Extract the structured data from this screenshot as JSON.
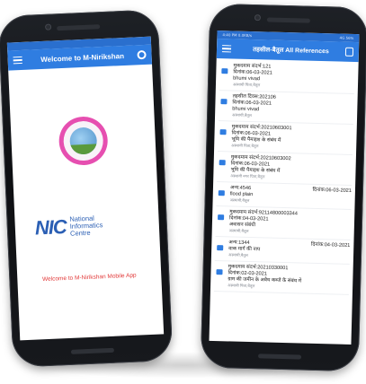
{
  "left_phone": {
    "app_bar": {
      "title": "Welcome to M-Nirikshan"
    },
    "org": {
      "mark": "NIC",
      "name_lines": [
        "National",
        "Informatics",
        "Centre"
      ]
    },
    "welcome_message": "Welcome to M-Nirikshan Mobile App"
  },
  "right_phone": {
    "status_bar": {
      "left": "4:40 PM 0.0KB/s",
      "right": "4G 56%"
    },
    "app_bar": {
      "title": "तहसील-बैतूल All References"
    },
    "items": [
      {
        "line1": "मुकदमाम संदर्भ:121",
        "line2": "दिनांक:06-03-2021",
        "line3": "bhumi vivad",
        "sub": "अस्थायी पिता,बैतूल"
      },
      {
        "line1": "तहसील दिवस:202106",
        "line2": "दिनांक:06-03-2021",
        "line3": "bhumi vivad",
        "sub": "अस्थायी,बैतूल"
      },
      {
        "line1": "मुकदमाम संदर्भ:20210603001",
        "line2": "दिनांक:06-03-2021",
        "line3": "भूमि की पैमाइश के संबंध में",
        "sub": "अस्थायी पिता,बैतूल"
      },
      {
        "line1": "मुकदमाम संदर्भ:20210603002",
        "line2": "दिनांक:06-03-2021",
        "line3": "भूमि की पैमाइश के संबंध में",
        "sub": "अस्थायी नगर पिता,बैतूल"
      },
      {
        "line1": "अन्य:4546",
        "date_right": "दिनांक:06-03-2021",
        "line3": "flood plain",
        "sub": "अस्थायी,बैतूल"
      },
      {
        "line1": "मुकदमाम संदर्भ:92114800003344",
        "line2": "दिनांक:04-03-2021",
        "line3": "अवासन संबंधी",
        "sub": "अस्थायी,बैतूल"
      },
      {
        "line1": "अन्य:1344",
        "date_right": "दिनांक:04-03-2021",
        "line3": "वाक मार्ग की नाप",
        "sub": "अस्थायी,बैतूल"
      },
      {
        "line1": "मुकदमाम संदर्भ:20210330001",
        "line2": "दिनांक:02-03-2021",
        "line3": "ग्राम की जमीन के अवैध कब्जे के संबंध में",
        "sub": "अस्थायी पिता,बैतूल"
      }
    ]
  },
  "colors": {
    "app_bar": "#2f7de1",
    "welcome_text": "#e23b3b",
    "nic_blue": "#2b5fb4",
    "logo_ring": "#e64fb0"
  }
}
